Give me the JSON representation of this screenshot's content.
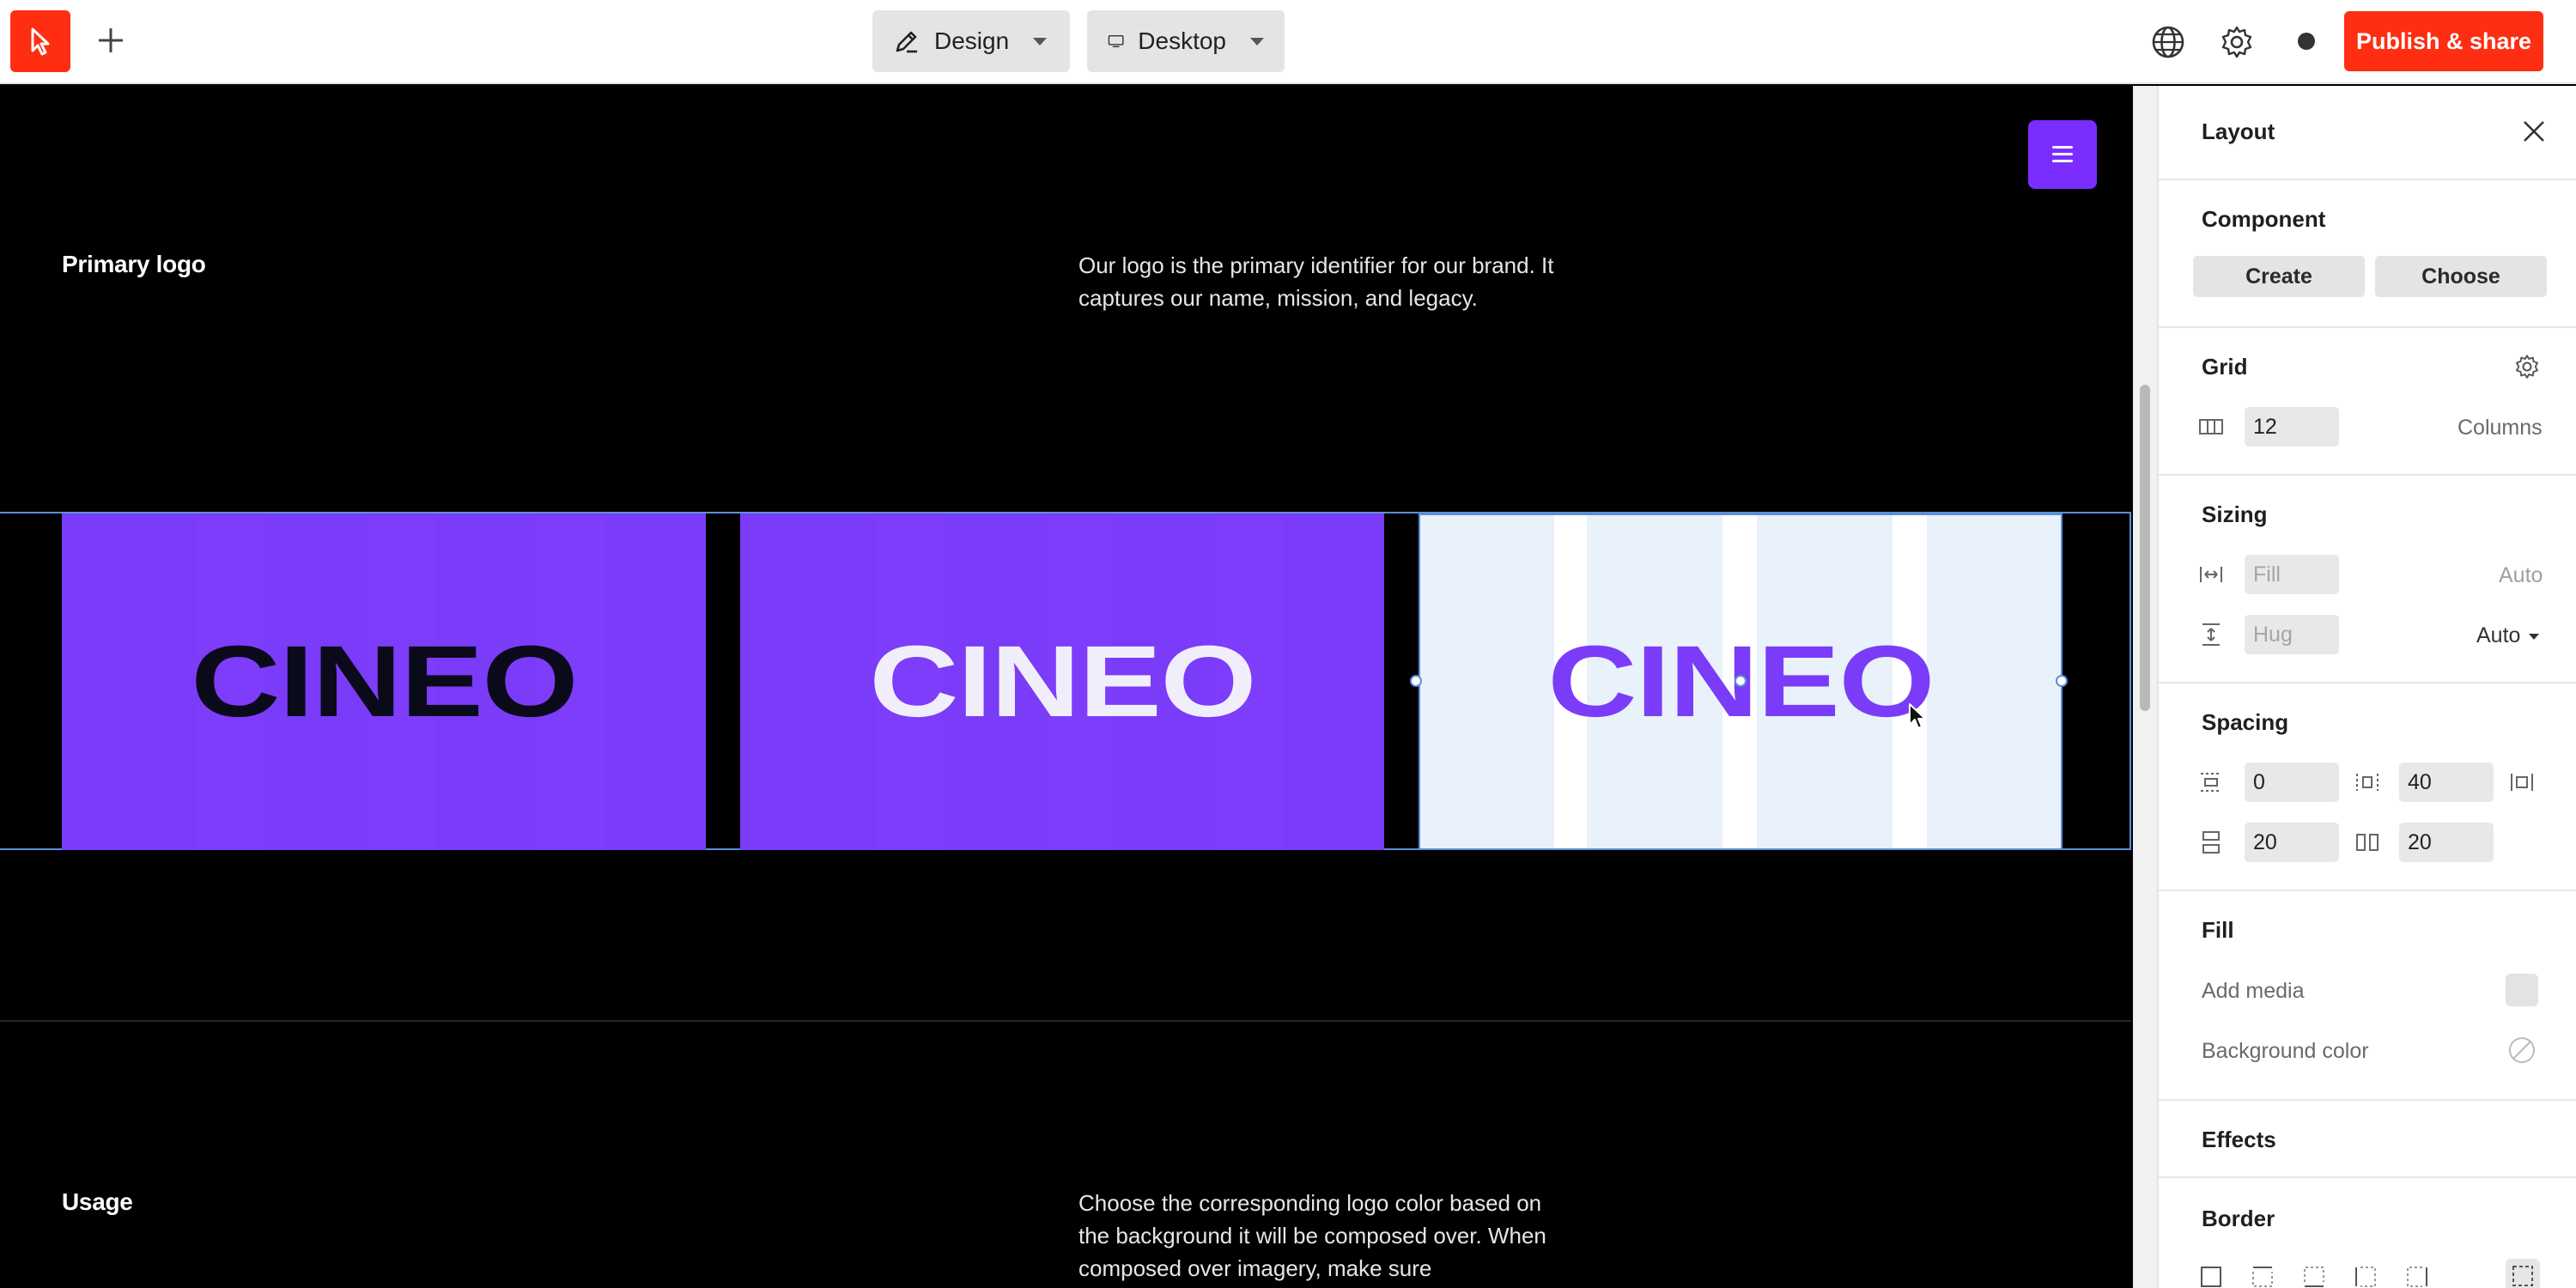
{
  "toolbar": {
    "mode_label": "Design",
    "device_label": "Desktop",
    "publish_label": "Publish & share"
  },
  "canvas": {
    "section1": {
      "title": "Primary logo",
      "body": "Our logo is the primary identifier for our brand. It captures our name, mission, and legacy."
    },
    "logo_cards": [
      {
        "word": "CINEO",
        "text_color": "#0b0a1a",
        "bg": "#7a3cf8"
      },
      {
        "word": "CINEO",
        "text_color": "#f1eefb",
        "bg": "#7a3cf8"
      },
      {
        "word": "CINEO",
        "text_color": "#7a3cf8",
        "bg": "#ffffff"
      }
    ],
    "section2": {
      "title": "Usage",
      "body": "Choose the corresponding logo color based on the background it will be composed over. When composed over imagery, make sure"
    }
  },
  "colors": {
    "accent_red": "#ff2e12",
    "brand_purple": "#7a3cf8",
    "selection_blue": "#5b8fd6"
  },
  "panel": {
    "title": "Layout",
    "component": {
      "heading": "Component",
      "create_label": "Create",
      "choose_label": "Choose"
    },
    "grid": {
      "heading": "Grid",
      "columns_value": "12",
      "columns_label": "Columns"
    },
    "sizing": {
      "heading": "Sizing",
      "width_placeholder": "Fill",
      "width_mode": "Auto",
      "height_placeholder": "Hug",
      "height_mode": "Auto"
    },
    "spacing": {
      "heading": "Spacing",
      "padding_vertical": "0",
      "padding_horizontal": "40",
      "gap_vertical": "20",
      "gap_horizontal": "20"
    },
    "fill": {
      "heading": "Fill",
      "add_media_label": "Add media",
      "background_color_label": "Background color"
    },
    "effects": {
      "heading": "Effects"
    },
    "border": {
      "heading": "Border"
    }
  }
}
